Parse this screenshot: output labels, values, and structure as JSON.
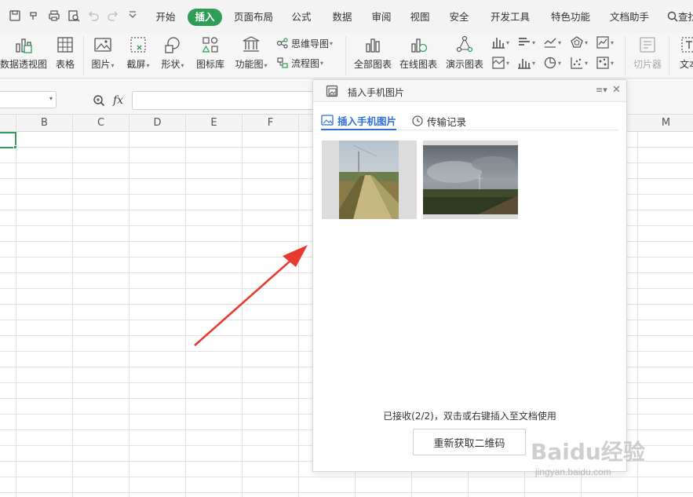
{
  "quick_access": [
    "save-icon",
    "redo-format-icon",
    "print-icon",
    "print-preview-icon",
    "undo-icon",
    "redo-icon",
    "more-icon"
  ],
  "menu": {
    "tabs": [
      "开始",
      "插入",
      "页面布局",
      "公式",
      "数据",
      "审阅",
      "视图",
      "安全",
      "开发工具",
      "特色功能",
      "文档助手"
    ],
    "active": "插入",
    "search_label": "查找"
  },
  "ribbon": {
    "pivot": "数据透视图",
    "table": "表格",
    "picture": "图片",
    "screenshot": "截屏",
    "shape": "形状",
    "icon_lib": "图标库",
    "func_chart": "功能图",
    "mindmap": "思维导图",
    "flowchart": "流程图",
    "all_charts": "全部图表",
    "online_charts": "在线图表",
    "demo_charts": "演示图表",
    "slicer": "切片器",
    "textbox": "文本"
  },
  "formula_bar": {
    "fx_label": "fx"
  },
  "columns": [
    "B",
    "C",
    "D",
    "E",
    "F",
    "M"
  ],
  "panel": {
    "title": "插入手机图片",
    "tabs": [
      "插入手机图片",
      "传输记录"
    ],
    "status": "已接收(2/2)，双击或右键插入至文档使用",
    "button": "重新获取二维码"
  },
  "colors": {
    "accent": "#2d9d57",
    "link": "#2f6fd6",
    "arrow": "#e83a2f"
  },
  "watermark": {
    "main": "Baidu经验",
    "sub": "jingyan.baidu.com"
  }
}
